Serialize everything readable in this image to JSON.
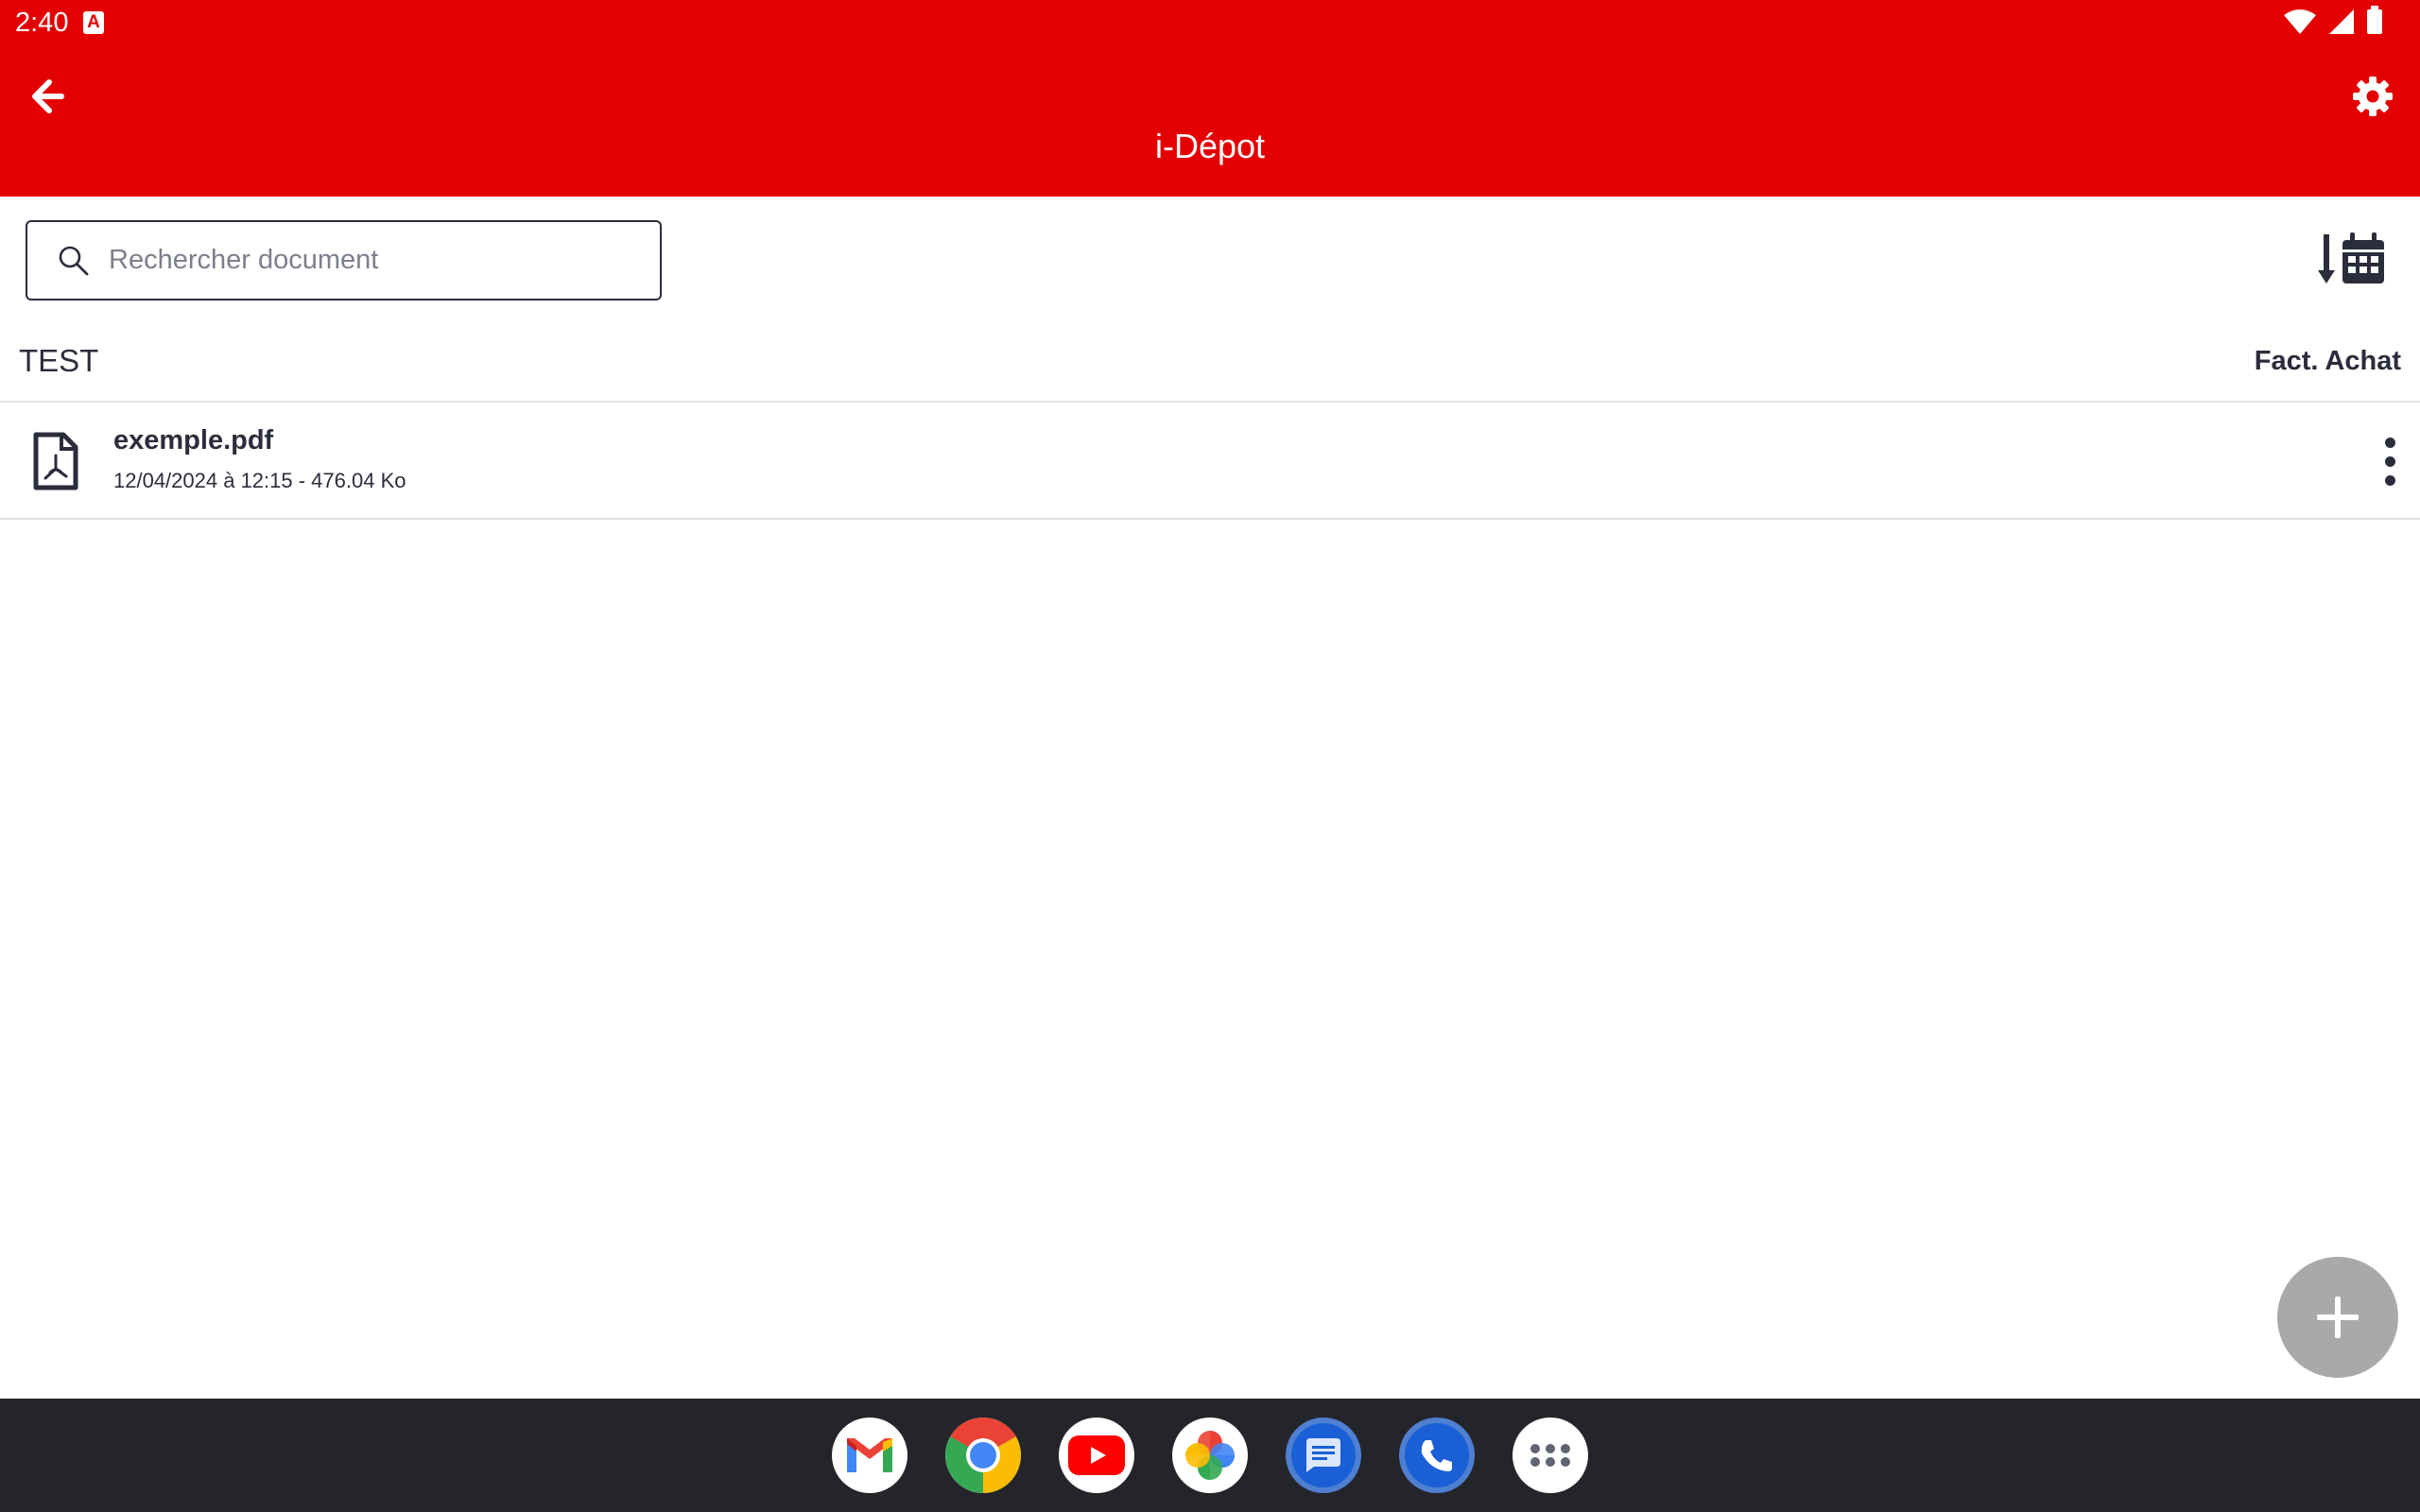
{
  "status_bar": {
    "time": "2:40",
    "notification_icon": "app-notification-icon",
    "icons": [
      "wifi-icon",
      "signal-icon",
      "battery-icon"
    ]
  },
  "toolbar": {
    "title": "i-Dépot",
    "back_icon": "arrow-left-icon",
    "settings_icon": "gear-icon"
  },
  "search": {
    "placeholder": "Rechercher document",
    "value": "",
    "icon": "search-icon"
  },
  "sort": {
    "icon": "sort-by-date-icon"
  },
  "folder": {
    "name": "TEST",
    "category": "Fact. Achat"
  },
  "documents": [
    {
      "name": "exemple.pdf",
      "meta": "12/04/2024 à 12:15 - 476.04 Ko",
      "icon": "pdf-file-icon"
    }
  ],
  "fab": {
    "icon": "plus-icon"
  },
  "dock": {
    "apps": [
      "gmail-icon",
      "chrome-icon",
      "youtube-icon",
      "photos-icon",
      "messages-icon",
      "phone-icon",
      "app-drawer-icon"
    ]
  },
  "colors": {
    "brand_red": "#e40000",
    "text_dark": "#2b2d3c",
    "fab_gray": "#a9a9a9",
    "dock_bg": "#24252b"
  }
}
